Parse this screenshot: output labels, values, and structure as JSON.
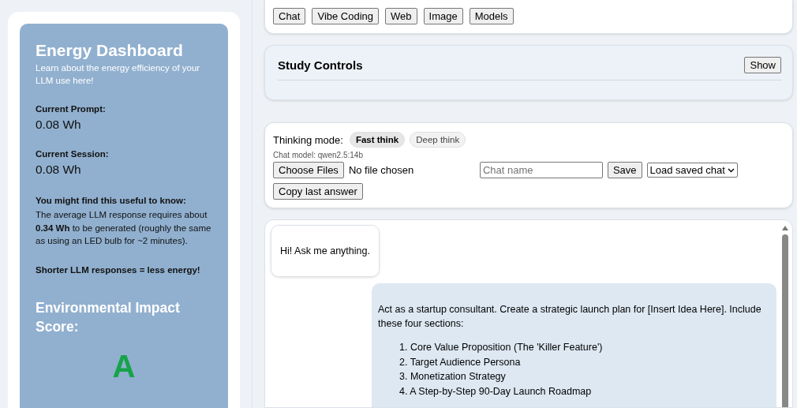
{
  "sidebar": {
    "title": "Energy Dashboard",
    "subtitle": "Learn about the energy efficiency of your LLM use here!",
    "stats": [
      {
        "label": "Current Prompt:",
        "value": "0.08 Wh"
      },
      {
        "label": "Current Session:",
        "value": "0.08 Wh"
      }
    ],
    "info": {
      "heading": "You might find this useful to know:",
      "text": "The average LLM response requires about **0.34 Wh** to be generated (roughly the same as using an LED bulb for ~2 minutes)."
    },
    "tip": "Shorter LLM responses = less energy!",
    "score": {
      "heading": "Environmental Impact Score:",
      "grade": "A",
      "color": "#16a34a"
    }
  },
  "nav": [
    "Chat",
    "Vibe Coding",
    "Web",
    "Image",
    "Models"
  ],
  "study_controls": {
    "title": "Study Controls",
    "button": "Show"
  },
  "chat_controls": {
    "thinking_label": "Thinking mode:",
    "modes": [
      {
        "label": "Fast think",
        "selected": true
      },
      {
        "label": "Deep think",
        "selected": false
      }
    ],
    "model": "Chat model: qwen2.5:14b",
    "file_button": "Choose Files",
    "file_status": "No file chosen",
    "chat_name": {
      "placeholder": "Chat name"
    },
    "save": "Save",
    "load": "Load saved chat",
    "copy": "Copy last answer"
  },
  "messages": [
    {
      "kind": "assistant",
      "text": "Hi! Ask me anything."
    },
    {
      "kind": "user",
      "text": "Act as a startup consultant. Create a strategic launch plan for [Insert Idea Here]. Include these four sections:",
      "items": [
        "1. Core Value Proposition (The 'Killer Feature')",
        "2. Target Audience Persona",
        "3. Monetization Strategy",
        "4. A Step-by-Step 90-Day Launch Roadmap"
      ]
    }
  ]
}
